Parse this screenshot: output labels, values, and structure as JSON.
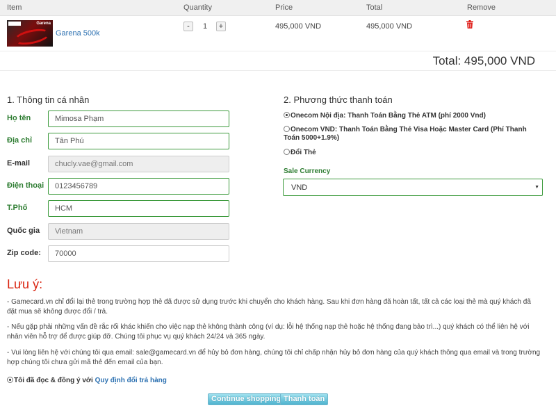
{
  "cart": {
    "headers": {
      "item": "Item",
      "quantity": "Quantity",
      "price": "Price",
      "total": "Total",
      "remove": "Remove"
    },
    "row": {
      "product_name": "Garena 500k",
      "quantity": "1",
      "price": "495,000 VND",
      "total": "495,000 VND",
      "minus": "-",
      "plus": "+",
      "thumb_logo": "Garena"
    },
    "grand_total": "Total: 495,000 VND"
  },
  "personal": {
    "title": "1. Thông tin cá nhân",
    "fields": [
      {
        "label": "Họ tên",
        "value": "Mimosa Phạm"
      },
      {
        "label": "Địa chỉ",
        "value": "Tân Phú"
      },
      {
        "label": "E-mail",
        "value": "chucly.vae@gmail.com"
      },
      {
        "label": "Điện thoại",
        "value": "0123456789"
      },
      {
        "label": "T.Phố",
        "value": "HCM"
      },
      {
        "label": "Quốc gia",
        "value": "Vietnam"
      },
      {
        "label": "Zip code:",
        "value": "70000"
      }
    ]
  },
  "payment": {
    "title": "2. Phương thức thanh toán",
    "options": [
      {
        "label": "Onecom Nội địa: Thanh Toán Bằng Thẻ ATM (phí 2000 Vnd)",
        "checked": true
      },
      {
        "label": "Onecom VND: Thanh Toán Bằng Thẻ Visa Hoặc Master Card (Phí Thanh Toán 5000+1.9%)",
        "checked": false
      },
      {
        "label": "Đổi Thẻ",
        "checked": false
      }
    ],
    "sale_currency_label": "Sale Currency",
    "currency": "VND"
  },
  "notes": {
    "title": "Lưu ý:",
    "items": [
      "- Gamecard.vn chỉ đổi lại thẻ trong trường hợp thẻ đã được sử dụng trước khi chuyển cho khách hàng. Sau khi đơn hàng đã hoàn tất, tất cả các loại thẻ mà quý khách đã đặt mua sẽ không được đổi / trả.",
      "- Nếu gặp phải những vấn đề rắc rối khác khiến cho việc nạp thẻ không thành công (ví dụ: lỗi hệ thống nạp thẻ hoặc hệ thống đang bảo trì...) quý khách có thể liên hệ với nhân viên hỗ trợ để được giúp đỡ. Chúng tôi phục vụ quý khách 24/24 và 365 ngày.",
      "- Vui lòng liên hệ với chúng tôi qua email: sale@gamecard.vn để hủy bỏ đơn hàng, chúng tôi chỉ chấp nhận hủy bỏ đơn hàng của quý khách thông qua email và trong trường hợp chúng tôi chưa gửi mã thẻ đến email của bạn."
    ]
  },
  "agree": {
    "text": "Tôi đã đọc & đồng ý với ",
    "link": "Quy định đổi trả hàng"
  },
  "buttons": {
    "continue": "Continue shopping",
    "checkout": "Thanh toán"
  },
  "colors": {
    "accent_green": "#3c9a3c",
    "note_red": "#d9230f",
    "button_blue": "#4fb3cf",
    "link": "#2a6fb0"
  }
}
